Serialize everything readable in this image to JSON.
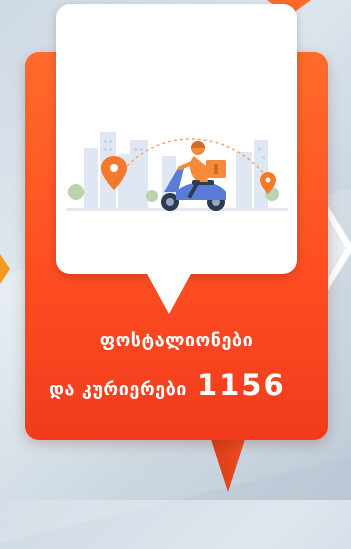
{
  "caption": {
    "line1": "ფოსტალიონები",
    "line2_text": "და კურიერები",
    "count": "1156"
  },
  "illustration": {
    "subject": "courier-on-scooter",
    "icons": [
      "location-pin-icon",
      "courier-scooter-icon",
      "city-skyline-icon"
    ]
  },
  "colors": {
    "card_orange": "#ff5a24",
    "accent_orange": "#f59a1f",
    "background": "#d4dde6",
    "white": "#ffffff"
  }
}
